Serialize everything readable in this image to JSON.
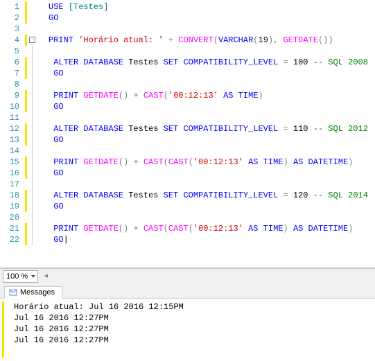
{
  "editor": {
    "lines": [
      {
        "num": 1,
        "yellowbar": true,
        "fold": "",
        "tokens": [
          {
            "cls": "kw",
            "t": "USE"
          },
          {
            "cls": "",
            "t": " "
          },
          {
            "cls": "br",
            "t": "[Testes]"
          }
        ]
      },
      {
        "num": 2,
        "yellowbar": true,
        "fold": "",
        "tokens": [
          {
            "cls": "kw",
            "t": "GO"
          }
        ]
      },
      {
        "num": 3,
        "yellowbar": false,
        "fold": "",
        "tokens": []
      },
      {
        "num": 4,
        "yellowbar": true,
        "fold": "box",
        "tokens": [
          {
            "cls": "kw",
            "t": "PRINT"
          },
          {
            "cls": "",
            "t": " "
          },
          {
            "cls": "str",
            "t": "'Horário atual: '"
          },
          {
            "cls": "",
            "t": " "
          },
          {
            "cls": "gray",
            "t": "+"
          },
          {
            "cls": "",
            "t": " "
          },
          {
            "cls": "func",
            "t": "CONVERT"
          },
          {
            "cls": "gray",
            "t": "("
          },
          {
            "cls": "kw",
            "t": "VARCHAR"
          },
          {
            "cls": "gray",
            "t": "("
          },
          {
            "cls": "num",
            "t": "19"
          },
          {
            "cls": "gray",
            "t": "),"
          },
          {
            "cls": "",
            "t": " "
          },
          {
            "cls": "func",
            "t": "GETDATE"
          },
          {
            "cls": "gray",
            "t": "())"
          }
        ]
      },
      {
        "num": 5,
        "yellowbar": false,
        "fold": "line",
        "tokens": []
      },
      {
        "num": 6,
        "yellowbar": true,
        "fold": "line",
        "indent": 1,
        "tokens": [
          {
            "cls": "kw",
            "t": "ALTER"
          },
          {
            "cls": "",
            "t": " "
          },
          {
            "cls": "kw",
            "t": "DATABASE"
          },
          {
            "cls": "",
            "t": " Testes "
          },
          {
            "cls": "kw",
            "t": "SET"
          },
          {
            "cls": "",
            "t": " "
          },
          {
            "cls": "kw",
            "t": "COMPATIBILITY_LEVEL"
          },
          {
            "cls": "",
            "t": " "
          },
          {
            "cls": "gray",
            "t": "="
          },
          {
            "cls": "",
            "t": " 100 "
          },
          {
            "cls": "comment",
            "t": "-- SQL 2008"
          }
        ]
      },
      {
        "num": 7,
        "yellowbar": true,
        "fold": "line",
        "indent": 1,
        "tokens": [
          {
            "cls": "kw",
            "t": "GO"
          }
        ]
      },
      {
        "num": 8,
        "yellowbar": false,
        "fold": "line",
        "tokens": []
      },
      {
        "num": 9,
        "yellowbar": true,
        "fold": "line",
        "indent": 1,
        "tokens": [
          {
            "cls": "kw",
            "t": "PRINT"
          },
          {
            "cls": "",
            "t": " "
          },
          {
            "cls": "func",
            "t": "GETDATE"
          },
          {
            "cls": "gray",
            "t": "()"
          },
          {
            "cls": "",
            "t": " "
          },
          {
            "cls": "gray",
            "t": "+"
          },
          {
            "cls": "",
            "t": " "
          },
          {
            "cls": "func",
            "t": "CAST"
          },
          {
            "cls": "gray",
            "t": "("
          },
          {
            "cls": "str",
            "t": "'00:12:13'"
          },
          {
            "cls": "",
            "t": " "
          },
          {
            "cls": "kw",
            "t": "AS"
          },
          {
            "cls": "",
            "t": " "
          },
          {
            "cls": "kw",
            "t": "TIME"
          },
          {
            "cls": "gray",
            "t": ")"
          }
        ]
      },
      {
        "num": 10,
        "yellowbar": true,
        "fold": "line",
        "indent": 1,
        "tokens": [
          {
            "cls": "kw",
            "t": "GO"
          }
        ]
      },
      {
        "num": 11,
        "yellowbar": false,
        "fold": "line",
        "tokens": []
      },
      {
        "num": 12,
        "yellowbar": true,
        "fold": "line",
        "indent": 1,
        "tokens": [
          {
            "cls": "kw",
            "t": "ALTER"
          },
          {
            "cls": "",
            "t": " "
          },
          {
            "cls": "kw",
            "t": "DATABASE"
          },
          {
            "cls": "",
            "t": " Testes "
          },
          {
            "cls": "kw",
            "t": "SET"
          },
          {
            "cls": "",
            "t": " "
          },
          {
            "cls": "kw",
            "t": "COMPATIBILITY_LEVEL"
          },
          {
            "cls": "",
            "t": " "
          },
          {
            "cls": "gray",
            "t": "="
          },
          {
            "cls": "",
            "t": " 110 "
          },
          {
            "cls": "comment",
            "t": "-- SQL 2012"
          }
        ]
      },
      {
        "num": 13,
        "yellowbar": true,
        "fold": "line",
        "indent": 1,
        "tokens": [
          {
            "cls": "kw",
            "t": "GO"
          }
        ]
      },
      {
        "num": 14,
        "yellowbar": false,
        "fold": "line",
        "tokens": []
      },
      {
        "num": 15,
        "yellowbar": true,
        "fold": "line",
        "indent": 1,
        "tokens": [
          {
            "cls": "kw",
            "t": "PRINT"
          },
          {
            "cls": "",
            "t": " "
          },
          {
            "cls": "func",
            "t": "GETDATE"
          },
          {
            "cls": "gray",
            "t": "()"
          },
          {
            "cls": "",
            "t": " "
          },
          {
            "cls": "gray",
            "t": "+"
          },
          {
            "cls": "",
            "t": " "
          },
          {
            "cls": "func",
            "t": "CAST"
          },
          {
            "cls": "gray",
            "t": "("
          },
          {
            "cls": "func",
            "t": "CAST"
          },
          {
            "cls": "gray",
            "t": "("
          },
          {
            "cls": "str",
            "t": "'00:12:13'"
          },
          {
            "cls": "",
            "t": " "
          },
          {
            "cls": "kw",
            "t": "AS"
          },
          {
            "cls": "",
            "t": " "
          },
          {
            "cls": "kw",
            "t": "TIME"
          },
          {
            "cls": "gray",
            "t": ")"
          },
          {
            "cls": "",
            "t": " "
          },
          {
            "cls": "kw",
            "t": "AS"
          },
          {
            "cls": "",
            "t": " "
          },
          {
            "cls": "kw",
            "t": "DATETIME"
          },
          {
            "cls": "gray",
            "t": ")"
          }
        ]
      },
      {
        "num": 16,
        "yellowbar": true,
        "fold": "line",
        "indent": 1,
        "tokens": [
          {
            "cls": "kw",
            "t": "GO"
          }
        ]
      },
      {
        "num": 17,
        "yellowbar": false,
        "fold": "line",
        "tokens": []
      },
      {
        "num": 18,
        "yellowbar": true,
        "fold": "line",
        "indent": 1,
        "tokens": [
          {
            "cls": "kw",
            "t": "ALTER"
          },
          {
            "cls": "",
            "t": " "
          },
          {
            "cls": "kw",
            "t": "DATABASE"
          },
          {
            "cls": "",
            "t": " Testes "
          },
          {
            "cls": "kw",
            "t": "SET"
          },
          {
            "cls": "",
            "t": " "
          },
          {
            "cls": "kw",
            "t": "COMPATIBILITY_LEVEL"
          },
          {
            "cls": "",
            "t": " "
          },
          {
            "cls": "gray",
            "t": "="
          },
          {
            "cls": "",
            "t": " 120 "
          },
          {
            "cls": "comment",
            "t": "-- SQL 2014"
          }
        ]
      },
      {
        "num": 19,
        "yellowbar": true,
        "fold": "line",
        "indent": 1,
        "tokens": [
          {
            "cls": "kw",
            "t": "GO"
          }
        ]
      },
      {
        "num": 20,
        "yellowbar": false,
        "fold": "line",
        "tokens": []
      },
      {
        "num": 21,
        "yellowbar": true,
        "fold": "line",
        "indent": 1,
        "tokens": [
          {
            "cls": "kw",
            "t": "PRINT"
          },
          {
            "cls": "",
            "t": " "
          },
          {
            "cls": "func",
            "t": "GETDATE"
          },
          {
            "cls": "gray",
            "t": "()"
          },
          {
            "cls": "",
            "t": " "
          },
          {
            "cls": "gray",
            "t": "+"
          },
          {
            "cls": "",
            "t": " "
          },
          {
            "cls": "func",
            "t": "CAST"
          },
          {
            "cls": "gray",
            "t": "("
          },
          {
            "cls": "func",
            "t": "CAST"
          },
          {
            "cls": "gray",
            "t": "("
          },
          {
            "cls": "str",
            "t": "'00:12:13'"
          },
          {
            "cls": "",
            "t": " "
          },
          {
            "cls": "kw",
            "t": "AS"
          },
          {
            "cls": "",
            "t": " "
          },
          {
            "cls": "kw",
            "t": "TIME"
          },
          {
            "cls": "gray",
            "t": ")"
          },
          {
            "cls": "",
            "t": " "
          },
          {
            "cls": "kw",
            "t": "AS"
          },
          {
            "cls": "",
            "t": " "
          },
          {
            "cls": "kw",
            "t": "DATETIME"
          },
          {
            "cls": "gray",
            "t": ")"
          }
        ]
      },
      {
        "num": 22,
        "yellowbar": true,
        "fold": "end",
        "indent": 1,
        "tokens": [
          {
            "cls": "kw",
            "t": "GO"
          },
          {
            "cls": "",
            "t": "|"
          }
        ]
      }
    ]
  },
  "zoom": {
    "value": "100 %",
    "arrow": "◂"
  },
  "tabs": {
    "messages": "Messages"
  },
  "messages": {
    "rows": [
      "Horário atual: Jul 16 2016 12:15PM",
      "Jul 16 2016 12:27PM",
      "Jul 16 2016 12:27PM",
      "Jul 16 2016 12:27PM"
    ]
  }
}
